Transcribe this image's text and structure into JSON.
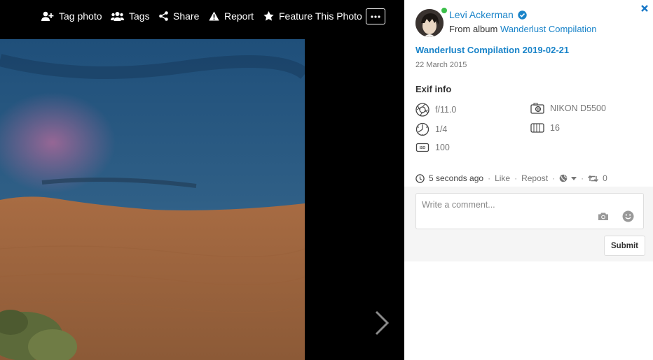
{
  "toolbar": {
    "tag_photo": "Tag photo",
    "tags": "Tags",
    "share": "Share",
    "report": "Report",
    "feature": "Feature This Photo",
    "more_icon": "ellipsis-icon"
  },
  "panel": {
    "close_icon": "close-icon",
    "user_name": "Levi Ackerman",
    "album_prefix": "From album",
    "album_name": "Wanderlust Compilation",
    "photo_title": "Wanderlust Compilation 2019-02-21",
    "photo_date": "22 March 2015",
    "exif_heading": "Exif info",
    "exif": {
      "aperture": "f/11.0",
      "camera": "NIKON D5500",
      "shutter": "1/4",
      "focal": "16",
      "iso": "100"
    },
    "meta": {
      "time": "5 seconds ago",
      "like": "Like",
      "repost": "Repost",
      "repost_count": "0"
    },
    "comment": {
      "placeholder": "Write a comment...",
      "submit": "Submit"
    }
  },
  "colors": {
    "link": "#1a84c9",
    "online": "#3bbf4a",
    "viewer_bg": "#000000"
  }
}
